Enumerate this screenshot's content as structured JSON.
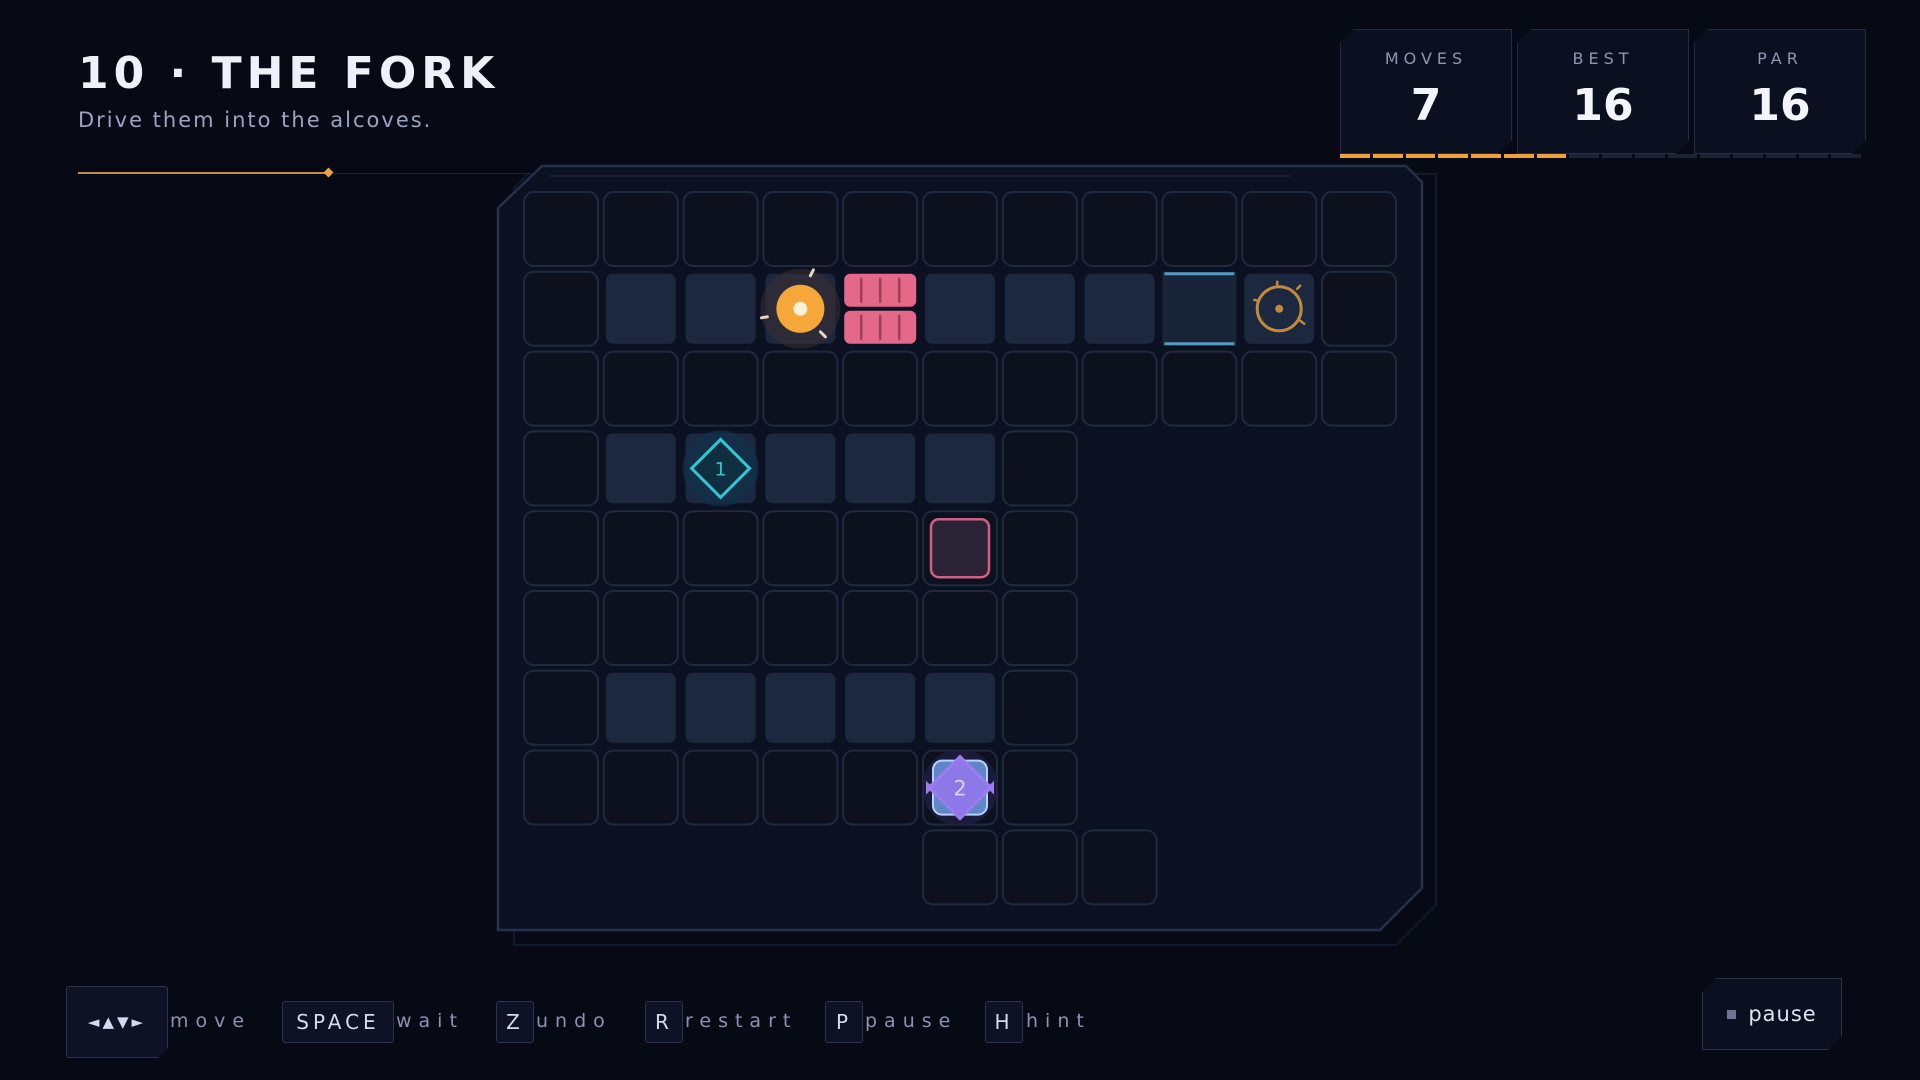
{
  "level": {
    "title": "10 · THE FORK",
    "subtitle": "Drive them into the alcoves."
  },
  "stats": {
    "moves_label": "MOVES",
    "moves": "7",
    "best_label": "BEST",
    "best": "16",
    "par_label": "PAR",
    "par": "16",
    "par_meter": {
      "segments": 16,
      "filled": 7
    }
  },
  "board": {
    "cols": 11,
    "rows": 9,
    "rows_layout": [
      "...........",
      ".DDPBDDDGT.",
      "...........",
      ".D1DDD.____",
      ".....S.____",
      ".......____",
      ".DDDDD.____",
      ".....2.____",
      "_____...___"
    ],
    "legend": {
      ".": "floor",
      "D": "raised-floor",
      "P": "player",
      "B": "barrier",
      "G": "gate",
      "T": "target",
      "1": "unit-1",
      "2": "unit-2",
      "S": "switch-pad",
      "_": "void"
    },
    "unit_labels": {
      "unit-1": "1",
      "unit-2": "2"
    },
    "colors": {
      "player": "#f6a73a",
      "barrier": "#e46887",
      "target": "#c08a3a",
      "unit-1": "#2fc6d8",
      "unit-2": "#9d7cf0",
      "switch": "#d0608a",
      "gate": "#4e9bc4"
    }
  },
  "controls": [
    {
      "key": "◄▲▼►",
      "label": "move"
    },
    {
      "key": "SPACE",
      "label": "wait"
    },
    {
      "key": "Z",
      "label": "undo"
    },
    {
      "key": "R",
      "label": "restart"
    },
    {
      "key": "P",
      "label": "pause"
    },
    {
      "key": "H",
      "label": "hint"
    }
  ],
  "pause_button": {
    "label": "pause"
  }
}
